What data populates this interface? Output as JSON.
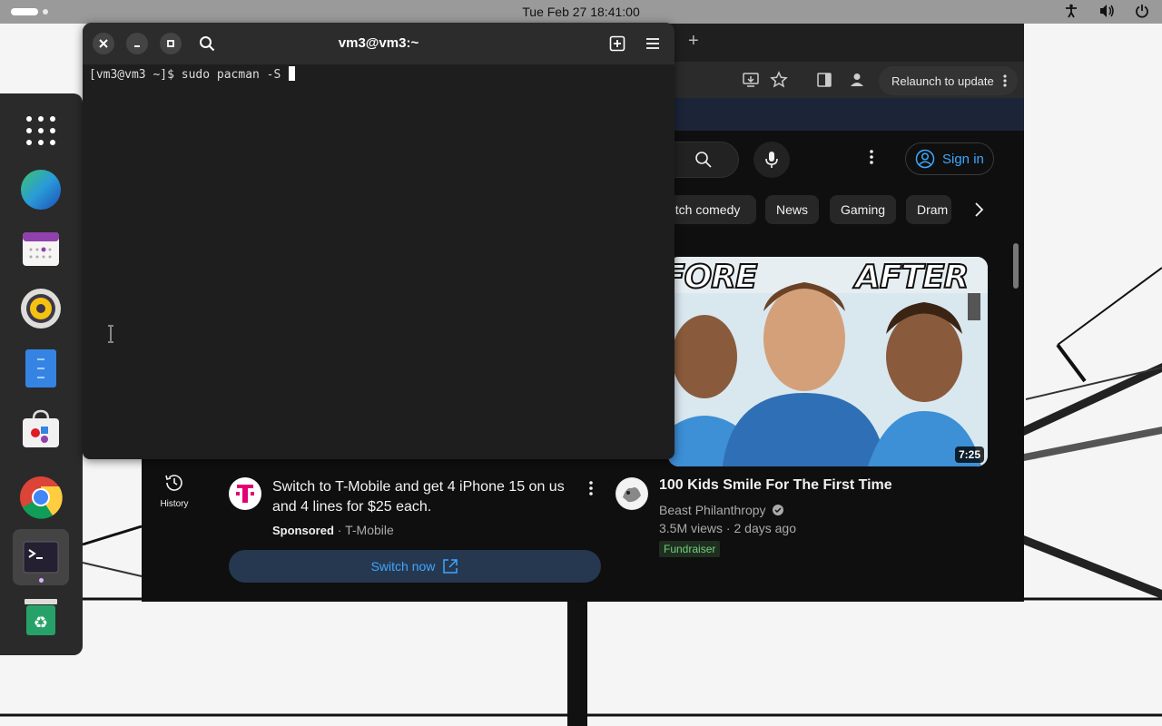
{
  "topbar": {
    "clock": "Tue Feb 27  18:41:00",
    "icons": [
      "accessibility-icon",
      "volume-icon",
      "power-icon"
    ]
  },
  "dock": {
    "items": [
      "app-grid",
      "web-browser",
      "calendar",
      "sound-player",
      "file-manager",
      "software-store",
      "chrome",
      "terminal",
      "trash"
    ]
  },
  "terminal": {
    "title": "vm3@vm3:~",
    "prompt": "[vm3@vm3 ~]$ ",
    "command": "sudo pacman -S "
  },
  "browser": {
    "new_tab": "+",
    "relaunch_label": "Relaunch to update",
    "signin_label": "Sign in",
    "chips": [
      "etch comedy",
      "News",
      "Gaming",
      "Dram"
    ],
    "history_label": "History",
    "ad": {
      "title": "Switch to T-Mobile and get 4 iPhone 15 on us and 4 lines for $25 each.",
      "sponsored": "Sponsored",
      "advertiser": "T-Mobile",
      "cta": "Switch now"
    },
    "video": {
      "thumb_left_text": "FORE",
      "thumb_right_text": "AFTER",
      "duration": "7:25",
      "title": "100 Kids Smile For The First Time",
      "channel": "Beast Philanthropy",
      "views": "3.5M views",
      "age": "2 days ago",
      "badge": "Fundraiser"
    }
  },
  "colors": {
    "accent_blue": "#3ea6ff",
    "terminal_bg": "#1e1e1e",
    "topbar_bg": "#9a9a9a"
  }
}
